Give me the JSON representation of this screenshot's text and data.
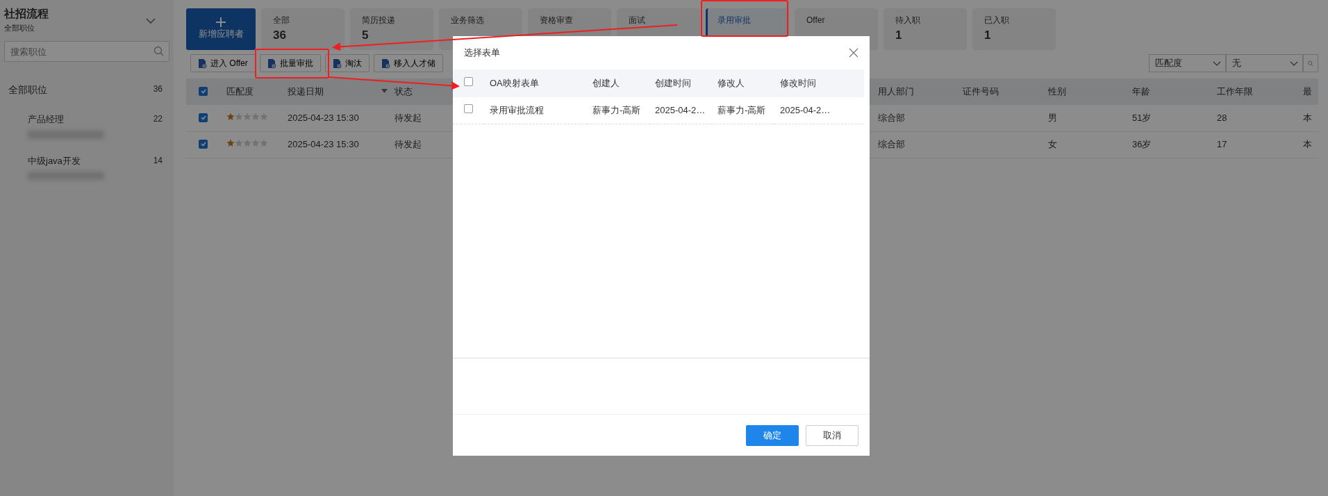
{
  "sidebar": {
    "title": "社招流程",
    "subtitle": "全部职位",
    "search": {
      "placeholder": "搜索职位"
    },
    "items": [
      {
        "label": "全部职位",
        "count": "36",
        "children": [
          {
            "label": "产品经理",
            "count": "22",
            "blurred_note": true
          },
          {
            "label": "中级java开发",
            "count": "14",
            "blurred_note": true
          }
        ]
      }
    ]
  },
  "add_button": {
    "label": "新增应聘者"
  },
  "stages": [
    {
      "label": "全部",
      "count": "36",
      "selected": false
    },
    {
      "label": "简历投递",
      "count": "5",
      "selected": false
    },
    {
      "label": "业务筛选",
      "selected": false
    },
    {
      "label": "资格审查",
      "selected": false
    },
    {
      "label": "面试",
      "selected": false
    },
    {
      "label": "录用审批",
      "selected": true
    },
    {
      "label": "Offer",
      "selected": false
    },
    {
      "label": "待入职",
      "count": "1",
      "selected": false
    },
    {
      "label": "已入职",
      "count": "1",
      "selected": false
    }
  ],
  "toolbar": [
    "进入 Offer",
    "批量审批",
    "淘汰",
    "移入人才储"
  ],
  "sort": {
    "field": "匹配度",
    "order": "无"
  },
  "table": {
    "header_checked": true,
    "columns": [
      {
        "label": "匹配度"
      },
      {
        "label": "投递日期",
        "sort": true
      },
      {
        "label": "状态"
      },
      {
        "label": "用人部门"
      },
      {
        "label": "证件号码"
      },
      {
        "label": "性别"
      },
      {
        "label": "年龄"
      },
      {
        "label": "工作年限"
      },
      {
        "label": "最"
      }
    ],
    "rows": [
      {
        "checked": true,
        "cells": [
          {
            "stars": 1
          },
          "2025-04-23 15:30",
          "待发起",
          "综合部",
          "",
          "男",
          "51岁",
          "28",
          "本"
        ]
      },
      {
        "checked": true,
        "cells": [
          {
            "stars": 1
          },
          "2025-04-23 15:30",
          "待发起",
          "综合部",
          "",
          "女",
          "36岁",
          "17",
          "本"
        ]
      }
    ]
  },
  "dialog": {
    "title": "选择表单",
    "header_checked": false,
    "columns": [
      "OA映射表单",
      "创建人",
      "创建时间",
      "修改人",
      "修改时间"
    ],
    "rows": [
      {
        "checked": false,
        "cells": [
          "录用审批流程",
          "薪事力-高斯",
          "2025-04-2…",
          "薪事力-高斯",
          "2025-04-2…"
        ]
      }
    ],
    "buttons": [
      {
        "label": "确定",
        "kind": "primary"
      },
      {
        "label": "取消",
        "kind": "default"
      }
    ]
  },
  "annotations": [
    {
      "kind": "box"
    },
    {
      "kind": "box"
    },
    {
      "kind": "arrow"
    },
    {
      "kind": "arrow"
    }
  ]
}
